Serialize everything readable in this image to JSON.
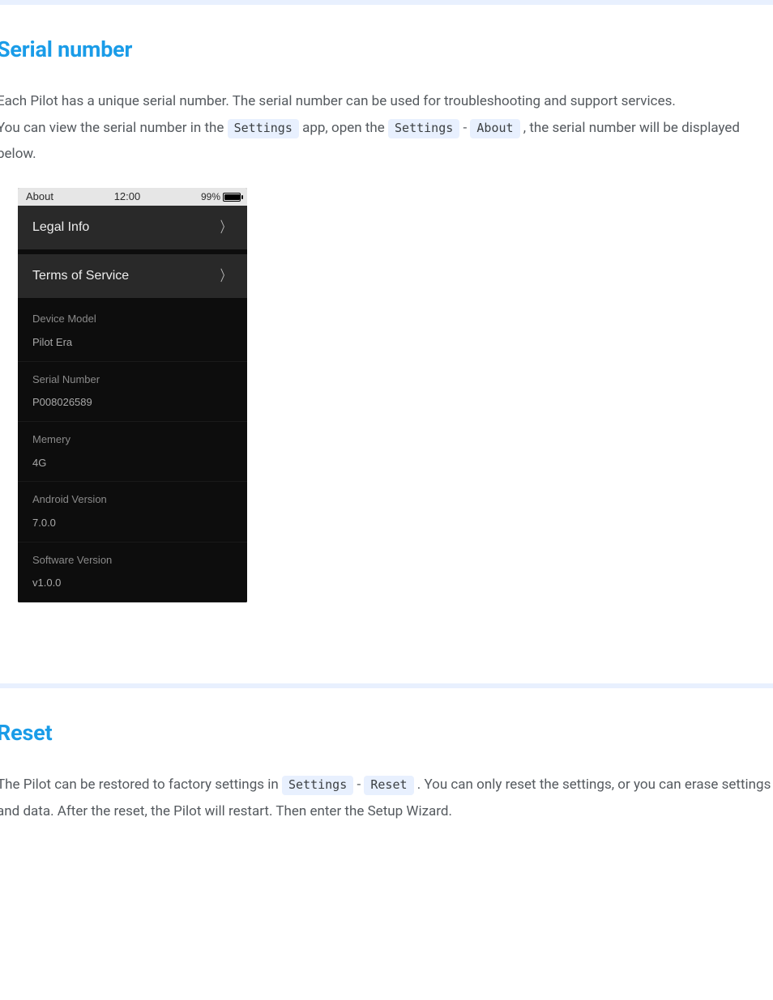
{
  "section1": {
    "heading": "Serial number",
    "p1a": "Each Pilot has a unique serial number. The serial number can be used for troubleshooting and support services.",
    "p2a": "You can view the serial number in the ",
    "code1": "Settings",
    "p2b": " app, open the ",
    "code2": "Settings",
    "sep1": " - ",
    "code3": "About",
    "p2c": " , the serial number will be displayed below."
  },
  "device": {
    "statusbar": {
      "title": "About",
      "time": "12:00",
      "battery_pct": "99%"
    },
    "menu": [
      {
        "label": "Legal Info"
      },
      {
        "label": "Terms of Service"
      }
    ],
    "info": [
      {
        "label": "Device Model",
        "value": "Pilot Era"
      },
      {
        "label": "Serial Number",
        "value": "P008026589"
      },
      {
        "label": "Memery",
        "value": "4G"
      },
      {
        "label": "Android Version",
        "value": "7.0.0"
      },
      {
        "label": "Software Version",
        "value": "v1.0.0"
      }
    ]
  },
  "section2": {
    "heading": "Reset",
    "p1a": "The Pilot can be restored to factory settings in ",
    "code1": "Settings",
    "sep1": " - ",
    "code2": "Reset",
    "p1b": " . You can only reset the settings, or you can erase settings and data. After the reset, the Pilot will restart. Then enter the Setup Wizard."
  }
}
